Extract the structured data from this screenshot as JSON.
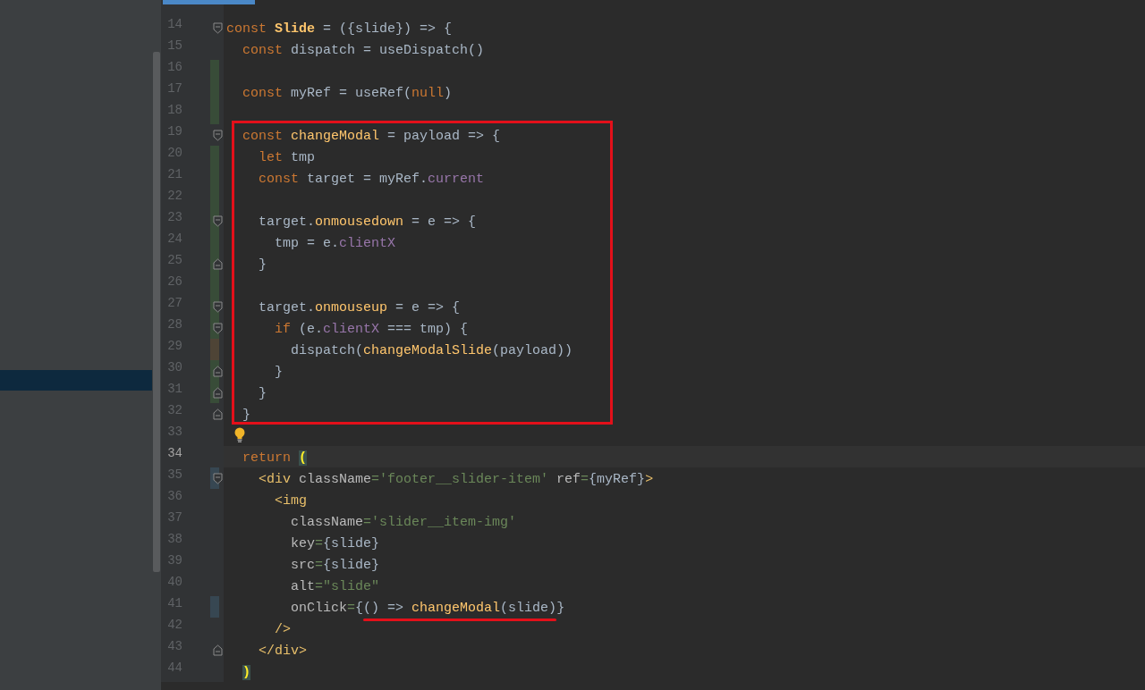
{
  "editor": {
    "lines": [
      {
        "number": "14",
        "fold_start": true,
        "tokens": [
          {
            "kind": "kw",
            "text": "const "
          },
          {
            "kind": "fn",
            "text": "Slide"
          },
          {
            "kind": "text",
            "text": " = ({slide}) => {"
          }
        ]
      },
      {
        "number": "15",
        "tokens": [
          {
            "kind": "kw",
            "text": "  const "
          },
          {
            "kind": "text",
            "text": "dispatch = useDispatch()"
          }
        ]
      },
      {
        "number": "16",
        "color": "#384c38"
      },
      {
        "number": "17",
        "color": "#384c38",
        "tokens": [
          {
            "kind": "kw",
            "text": "  const "
          },
          {
            "kind": "text",
            "text": "myRef = useRef("
          },
          {
            "kind": "kw",
            "text": "null"
          },
          {
            "kind": "text",
            "text": ")"
          }
        ]
      },
      {
        "number": "18",
        "color": "#384c38"
      },
      {
        "number": "19",
        "fold_start": true,
        "boxed": true,
        "tokens": [
          {
            "kind": "kw",
            "text": "  const "
          },
          {
            "kind": "fn",
            "text": "changeModal"
          },
          {
            "kind": "text",
            "text": " = payload => {"
          }
        ]
      },
      {
        "number": "20",
        "color": "#384c38",
        "boxed": true,
        "tokens": [
          {
            "kind": "kw",
            "text": "    let "
          },
          {
            "kind": "text",
            "text": "tmp"
          }
        ]
      },
      {
        "number": "21",
        "color": "#384c38",
        "boxed": true,
        "tokens": [
          {
            "kind": "kw",
            "text": "    const "
          },
          {
            "kind": "text",
            "text": "target = myRef."
          },
          {
            "kind": "prop",
            "text": "current"
          }
        ]
      },
      {
        "number": "22",
        "color": "#384c38",
        "boxed": true
      },
      {
        "number": "23",
        "color": "#384c38",
        "fold_start": true,
        "boxed": true,
        "tokens": [
          {
            "kind": "text",
            "text": "    target."
          },
          {
            "kind": "fn",
            "text": "onmousedown"
          },
          {
            "kind": "text",
            "text": " = e => {"
          }
        ]
      },
      {
        "number": "24",
        "color": "#384c38",
        "boxed": true,
        "tokens": [
          {
            "kind": "text",
            "text": "      tmp = e."
          },
          {
            "kind": "prop",
            "text": "clientX"
          }
        ]
      },
      {
        "number": "25",
        "color": "#384c38",
        "fold_end": true,
        "boxed": true,
        "tokens": [
          {
            "kind": "text",
            "text": "    }"
          }
        ]
      },
      {
        "number": "26",
        "color": "#384c38",
        "boxed": true
      },
      {
        "number": "27",
        "color": "#384c38",
        "fold_start": true,
        "boxed": true,
        "tokens": [
          {
            "kind": "text",
            "text": "    target."
          },
          {
            "kind": "fn",
            "text": "onmouseup"
          },
          {
            "kind": "text",
            "text": " = e => {"
          }
        ]
      },
      {
        "number": "28",
        "color": "#384c38",
        "fold_start": true,
        "boxed": true,
        "tokens": [
          {
            "kind": "kw",
            "text": "      if "
          },
          {
            "kind": "text",
            "text": "(e."
          },
          {
            "kind": "prop",
            "text": "clientX"
          },
          {
            "kind": "text",
            "text": " === tmp) {"
          }
        ]
      },
      {
        "number": "29",
        "color": "#4e4436",
        "boxed": true,
        "tokens": [
          {
            "kind": "text",
            "text": "        dispatch("
          },
          {
            "kind": "fn",
            "text": "changeModalSlide"
          },
          {
            "kind": "text",
            "text": "(payload))"
          }
        ]
      },
      {
        "number": "30",
        "color": "#384c38",
        "fold_end": true,
        "boxed": true,
        "tokens": [
          {
            "kind": "text",
            "text": "      }"
          }
        ]
      },
      {
        "number": "31",
        "color": "#384c38",
        "fold_end": true,
        "boxed": true,
        "tokens": [
          {
            "kind": "text",
            "text": "    }"
          }
        ]
      },
      {
        "number": "32",
        "fold_end": true,
        "boxed": true,
        "tokens": [
          {
            "kind": "text",
            "text": "  }"
          }
        ]
      },
      {
        "number": "33",
        "bulb": true
      },
      {
        "number": "34",
        "current": true,
        "tokens": [
          {
            "kind": "kw",
            "text": "  return "
          },
          {
            "kind": "paren",
            "text": "("
          }
        ]
      },
      {
        "number": "35",
        "color": "#374752",
        "fold_start": true,
        "tokens": [
          {
            "kind": "tag",
            "text": "    <div "
          },
          {
            "kind": "attr",
            "text": "className"
          },
          {
            "kind": "str",
            "text": "='footer__slider-item'"
          },
          {
            "kind": "attr",
            "text": " ref"
          },
          {
            "kind": "str",
            "text": "="
          },
          {
            "kind": "text",
            "text": "{myRef}"
          },
          {
            "kind": "tag",
            "text": ">"
          }
        ]
      },
      {
        "number": "36",
        "tokens": [
          {
            "kind": "tag",
            "text": "      <img"
          }
        ]
      },
      {
        "number": "37",
        "tokens": [
          {
            "kind": "attr",
            "text": "        className"
          },
          {
            "kind": "str",
            "text": "='slider__item-img'"
          }
        ]
      },
      {
        "number": "38",
        "tokens": [
          {
            "kind": "attr",
            "text": "        key"
          },
          {
            "kind": "str",
            "text": "="
          },
          {
            "kind": "text",
            "text": "{slide}"
          }
        ]
      },
      {
        "number": "39",
        "tokens": [
          {
            "kind": "attr",
            "text": "        src"
          },
          {
            "kind": "str",
            "text": "="
          },
          {
            "kind": "text",
            "text": "{slide}"
          }
        ]
      },
      {
        "number": "40",
        "tokens": [
          {
            "kind": "attr",
            "text": "        alt"
          },
          {
            "kind": "str",
            "text": "=\"slide\""
          }
        ]
      },
      {
        "number": "41",
        "color": "#374752",
        "tokens": [
          {
            "kind": "attr",
            "text": "        onClick"
          },
          {
            "kind": "str",
            "text": "="
          },
          {
            "kind": "text",
            "text": "{"
          },
          {
            "kind": "text",
            "text": "() => ",
            "underlined": true
          },
          {
            "kind": "fn",
            "text": "changeModal",
            "underlined": true
          },
          {
            "kind": "text",
            "text": "(slide)",
            "underlined": true
          },
          {
            "kind": "text",
            "text": "}"
          }
        ]
      },
      {
        "number": "42",
        "tokens": [
          {
            "kind": "tag",
            "text": "      />"
          }
        ]
      },
      {
        "number": "43",
        "fold_end": true,
        "tokens": [
          {
            "kind": "tag",
            "text": "    </div>"
          }
        ]
      },
      {
        "number": "44",
        "tokens": [
          {
            "kind": "paren",
            "text": "  )"
          }
        ]
      }
    ]
  }
}
